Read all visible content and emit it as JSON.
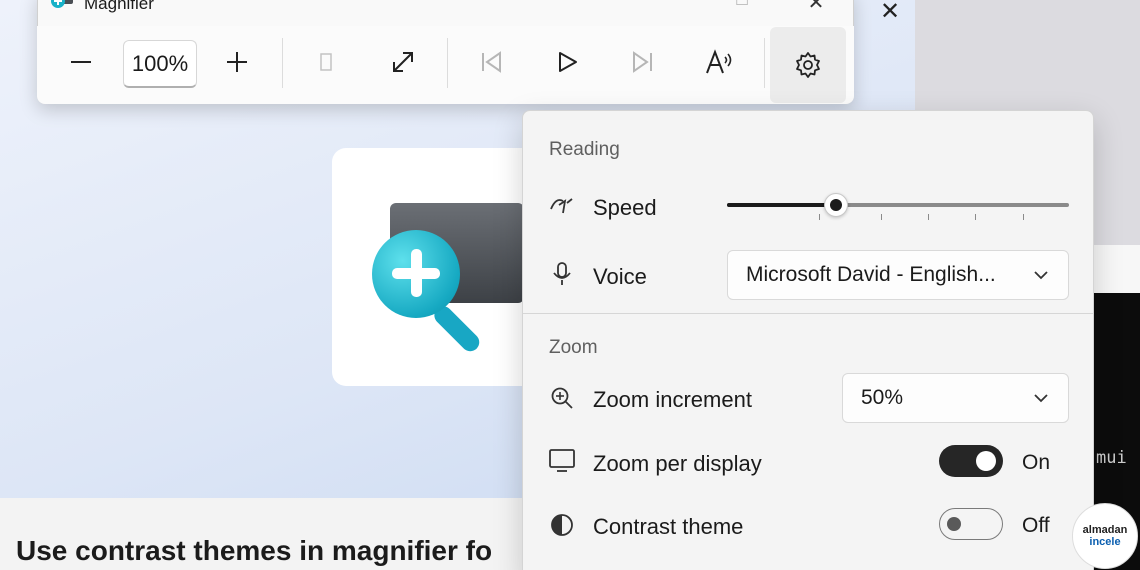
{
  "magnifier": {
    "title": "Magnifier",
    "zoom_level": "100%",
    "window_controls": {
      "minimize": "—",
      "maximize": "☐",
      "close": "✕"
    },
    "toolbar_icons": [
      "minus-icon",
      "plus-icon",
      "view-mode-icon",
      "expand-icon",
      "previous-icon",
      "play-icon",
      "next-icon",
      "read-from-here-icon",
      "settings-gear-icon"
    ]
  },
  "background": {
    "article_title": "Use contrast themes in magnifier fo",
    "close_glyph": "✕",
    "terminal_text": "mui"
  },
  "flyout": {
    "reading_section": "Reading",
    "speed": {
      "label": "Speed",
      "value_fraction": 0.32
    },
    "voice": {
      "label": "Voice",
      "selected": "Microsoft David - English..."
    },
    "zoom_section": "Zoom",
    "zoom_increment": {
      "label": "Zoom increment",
      "selected": "50%"
    },
    "zoom_per_display": {
      "label": "Zoom per display",
      "state": "On"
    },
    "contrast_theme": {
      "label": "Contrast theme",
      "state": "Off"
    }
  },
  "watermark": {
    "line1": "almadan",
    "line2": "incele"
  }
}
